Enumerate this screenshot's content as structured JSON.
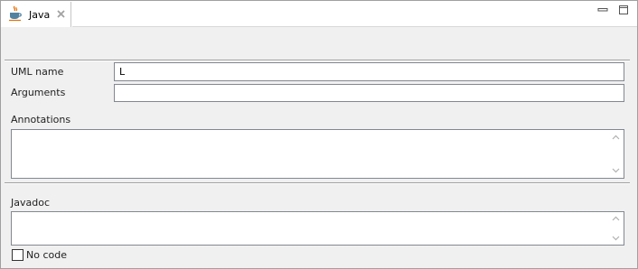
{
  "tab": {
    "label": "Java",
    "icon": "java-coffee-cup-icon"
  },
  "window_controls": {
    "minimize_icon": "minimize-icon",
    "maximize_icon": "maximize-icon"
  },
  "form": {
    "uml_name": {
      "label": "UML name",
      "value": "L"
    },
    "arguments": {
      "label": "Arguments",
      "value": ""
    },
    "annotations": {
      "label": "Annotations",
      "value": ""
    },
    "javadoc": {
      "label": "Javadoc",
      "value": ""
    },
    "no_code": {
      "label": "No code",
      "checked": false
    }
  },
  "colors": {
    "panel_bg": "#f0f0f0",
    "field_border": "#828790",
    "separator": "#a0a0a0"
  }
}
